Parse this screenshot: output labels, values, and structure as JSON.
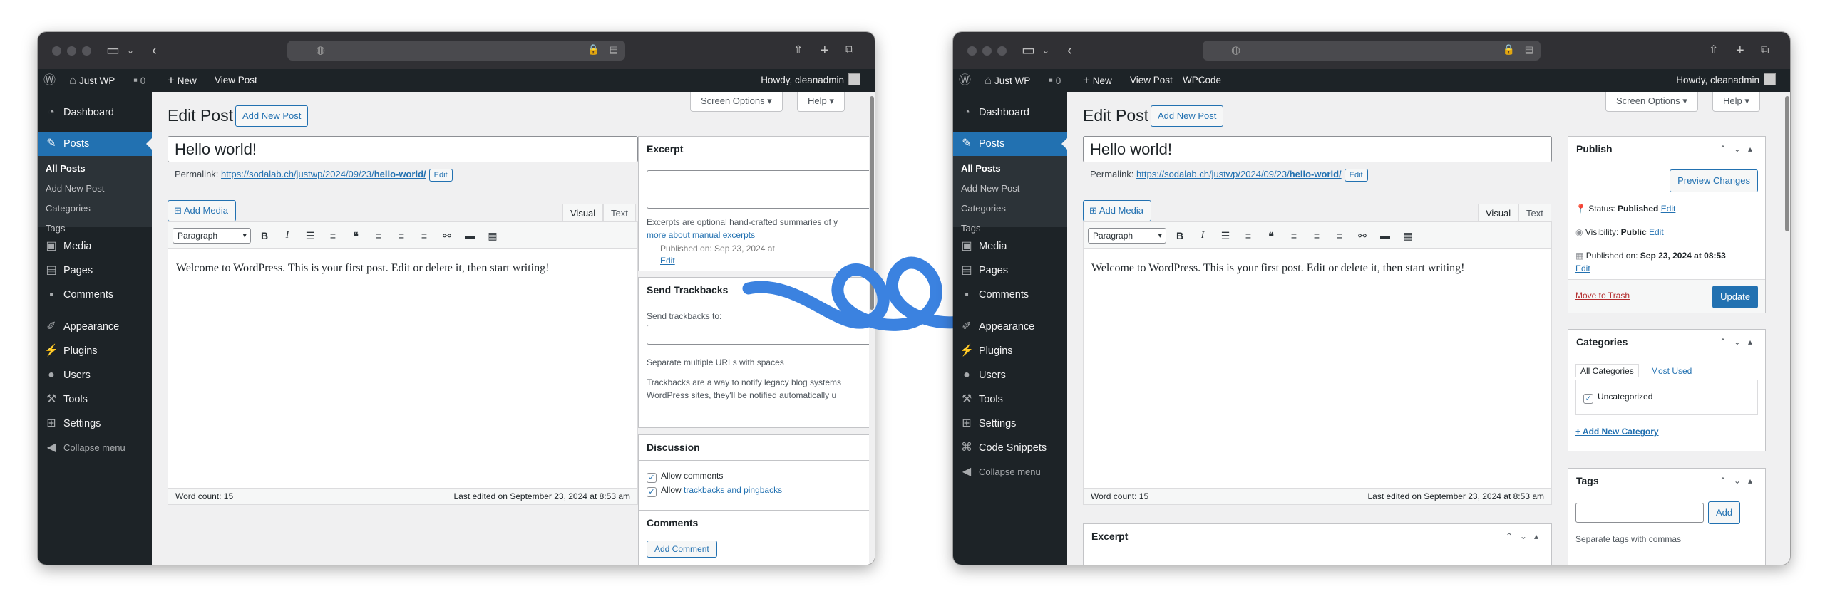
{
  "colors": {
    "accent": "#2271b1",
    "adminbar": "#1d2327",
    "arrow": "#3b82e0",
    "trash": "#b32d2e"
  },
  "browser": {
    "globe_icon": "globe-icon",
    "lock_icon": "lock-icon"
  },
  "adminbar": {
    "site": "Just WP",
    "comments_count": "0",
    "new_label": "New",
    "view_post": "View Post",
    "wpcode": "WPCode",
    "howdy": "Howdy, cleanadmin"
  },
  "menu": {
    "dashboard": "Dashboard",
    "posts": "Posts",
    "all_posts": "All Posts",
    "add_new_post": "Add New Post",
    "categories": "Categories",
    "tags": "Tags",
    "media": "Media",
    "pages": "Pages",
    "comments": "Comments",
    "appearance": "Appearance",
    "plugins": "Plugins",
    "users": "Users",
    "tools": "Tools",
    "settings": "Settings",
    "code_snippets": "Code Snippets",
    "collapse": "Collapse menu"
  },
  "screen": {
    "screen_options": "Screen Options",
    "help": "Help"
  },
  "editor": {
    "heading": "Edit Post",
    "add_new": "Add New Post",
    "title": "Hello world!",
    "permalink_label": "Permalink:",
    "permalink_base": "https://sodalab.ch/justwp/2024/09/23/",
    "permalink_slug": "hello-world/",
    "edit": "Edit",
    "add_media": "Add Media",
    "tab_visual": "Visual",
    "tab_text": "Text",
    "format": "Paragraph",
    "body": "Welcome to WordPress. This is your first post. Edit or delete it, then start writing!",
    "word_count": "Word count: 15",
    "last_edited": "Last edited on September 23, 2024 at 8:53 am"
  },
  "left_panel": {
    "excerpt": "Excerpt",
    "excerpt_help": "Excerpts are optional hand-crafted summaries of y",
    "excerpt_link": "more about manual excerpts",
    "excerpt_partial": "Published on: Sep 23, 2024 at",
    "edit": "Edit",
    "send_trackbacks": "Send Trackbacks",
    "send_to": "Send trackbacks to:",
    "separate": "Separate multiple URLs with spaces",
    "tb_text1": "Trackbacks are a way to notify legacy blog systems",
    "tb_text2": "WordPress sites, they'll be notified automatically u",
    "discussion": "Discussion",
    "allow_comments": "Allow comments",
    "allow_prefix": "Allow",
    "trackbacks_link": "trackbacks and pingbacks",
    "comments": "Comments",
    "add_comment": "Add Comment"
  },
  "publish": {
    "title": "Publish",
    "preview": "Preview Changes",
    "status_label": "Status:",
    "status": "Published",
    "visibility_label": "Visibility:",
    "visibility": "Public",
    "published_on_label": "Published on:",
    "published_on": "Sep 23, 2024 at 08:53",
    "edit": "Edit",
    "trash": "Move to Trash",
    "update": "Update"
  },
  "categories": {
    "title": "Categories",
    "tab_all": "All Categories",
    "tab_used": "Most Used",
    "item": "Uncategorized",
    "add_new": "+ Add New Category"
  },
  "tags": {
    "title": "Tags",
    "add": "Add",
    "help": "Separate tags with commas"
  },
  "excerpt_box": {
    "title": "Excerpt"
  }
}
